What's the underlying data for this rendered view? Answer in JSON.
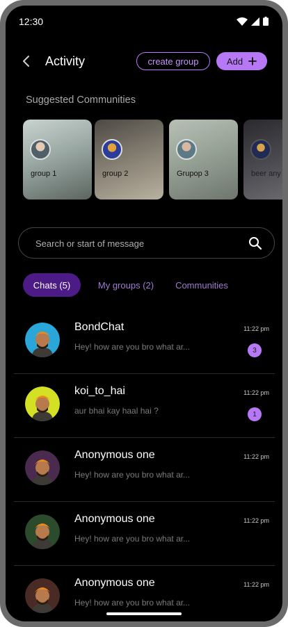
{
  "status_bar": {
    "time": "12:30"
  },
  "header": {
    "title": "Activity",
    "create_group_label": "create group",
    "add_label": "Add"
  },
  "suggested": {
    "title": "Suggested Communities",
    "cards": [
      {
        "label": "group 1"
      },
      {
        "label": "group 2"
      },
      {
        "label": "Grupop 3"
      },
      {
        "label": "beer any"
      }
    ]
  },
  "search": {
    "placeholder": "Search or start of message"
  },
  "tabs": [
    {
      "label": "Chats (5)"
    },
    {
      "label": "My groups (2)"
    },
    {
      "label": "Communities"
    }
  ],
  "chats": [
    {
      "name": "BondChat",
      "message": "Hey! how are you bro what ar...",
      "time": "11:22 pm",
      "unread": "3"
    },
    {
      "name": "koi_to_hai",
      "message": "aur bhai kay haal hai ?",
      "time": "11:22 pm",
      "unread": "1"
    },
    {
      "name": "Anonymous one",
      "message": "Hey! how are you bro what ar...",
      "time": "11:22 pm"
    },
    {
      "name": "Anonymous one",
      "message": "Hey! how are you bro what ar...",
      "time": "11:22 pm"
    },
    {
      "name": "Anonymous one",
      "message": "Hey! how are you bro what ar...",
      "time": "11:22 pm"
    }
  ],
  "colors": {
    "accent": "#b678f5",
    "active_tab": "#4c1b86",
    "background": "#000000"
  }
}
